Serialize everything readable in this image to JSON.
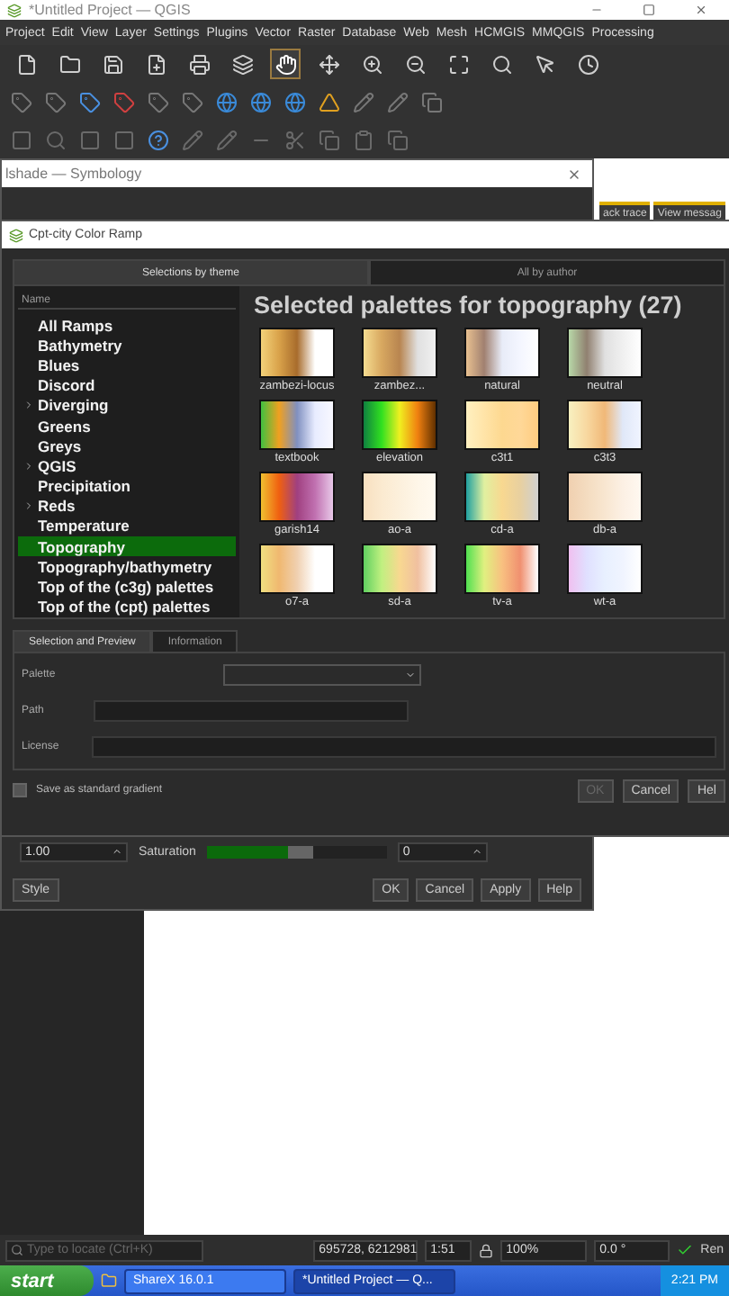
{
  "main_window": {
    "title": "*Untitled Project — QGIS"
  },
  "menu": [
    "Project",
    "Edit",
    "View",
    "Layer",
    "Settings",
    "Plugins",
    "Vector",
    "Raster",
    "Database",
    "Web",
    "Mesh",
    "HCMGIS",
    "MMQGIS",
    "Processing"
  ],
  "toolbar": {
    "tools": [
      {
        "selected": false
      },
      {
        "selected": false
      },
      {
        "selected": false
      },
      {
        "selected": false
      },
      {
        "selected": false
      },
      {
        "selected": false
      },
      {
        "selected": true
      },
      {
        "selected": false
      },
      {
        "selected": false
      },
      {
        "selected": false
      },
      {
        "selected": false
      },
      {
        "selected": false
      },
      {
        "selected": false
      },
      {
        "selected": false
      }
    ]
  },
  "dock_tabs": [
    "ack trace",
    "View messag"
  ],
  "symbology_dialog": {
    "title": "lshade — Symbology",
    "brightness_value": "1.00",
    "saturation_label": "Saturation",
    "saturation": {
      "level": 0.45
    },
    "saturation_value": "0",
    "style_button": "Style",
    "buttons": [
      "OK",
      "Cancel",
      "Apply",
      "Help"
    ]
  },
  "cpt_dialog": {
    "title": "Cpt-city Color Ramp",
    "tabs": [
      {
        "label": "Selections by theme",
        "selected": true
      },
      {
        "label": "All by author",
        "selected": false
      }
    ],
    "tree": {
      "header": "Name",
      "items": [
        {
          "label": "All Ramps",
          "expandable": false,
          "selected": false
        },
        {
          "label": "Bathymetry",
          "expandable": false,
          "selected": false
        },
        {
          "label": "Blues",
          "expandable": false,
          "selected": false
        },
        {
          "label": "Discord",
          "expandable": false,
          "selected": false
        },
        {
          "label": "Diverging",
          "expandable": true,
          "selected": false
        },
        {
          "label": "Greens",
          "expandable": false,
          "selected": false
        },
        {
          "label": "Greys",
          "expandable": false,
          "selected": false
        },
        {
          "label": "QGIS",
          "expandable": true,
          "selected": false
        },
        {
          "label": "Precipitation",
          "expandable": false,
          "selected": false
        },
        {
          "label": "Reds",
          "expandable": true,
          "selected": false
        },
        {
          "label": "Temperature",
          "expandable": false,
          "selected": false
        },
        {
          "label": "Topography",
          "expandable": false,
          "selected": true
        },
        {
          "label": "Topography/bathymetry",
          "expandable": false,
          "selected": false
        },
        {
          "label": "Top of the (c3g) palettes",
          "expandable": false,
          "selected": false
        },
        {
          "label": "Top of the (cpt) palettes",
          "expandable": false,
          "selected": false
        }
      ]
    },
    "heading": "Selected palettes for topography (27)",
    "palettes": [
      {
        "name": "zambezi-locus",
        "kind": "picture"
      },
      {
        "name": "zambez...",
        "kind": "picture"
      },
      {
        "name": "natural",
        "kind": "picture"
      },
      {
        "name": "neutral",
        "kind": "picture"
      },
      {
        "name": "textbook",
        "kind": "picture"
      },
      {
        "name": "elevation",
        "kind": "picture"
      },
      {
        "name": "c3t1",
        "kind": "picture"
      },
      {
        "name": "c3t3",
        "kind": "picture"
      },
      {
        "name": "garish14",
        "kind": "picture"
      },
      {
        "name": "ao-a",
        "kind": "picture"
      },
      {
        "name": "cd-a",
        "kind": "picture"
      },
      {
        "name": "db-a",
        "kind": "picture"
      },
      {
        "name": "o7-a",
        "kind": "picture"
      },
      {
        "name": "sd-a",
        "kind": "picture"
      },
      {
        "name": "tv-a",
        "kind": "picture"
      },
      {
        "name": "wt-a",
        "kind": "picture"
      }
    ],
    "detail_tabs": [
      {
        "label": "Selection and Preview",
        "selected": true
      },
      {
        "label": "Information",
        "selected": false
      }
    ],
    "fields": [
      {
        "label": "Palette",
        "kind": "dropdown"
      },
      {
        "label": "Path",
        "kind": "text"
      },
      {
        "label": "License",
        "kind": "text"
      }
    ],
    "save_standard": {
      "label": "Save as standard gradient",
      "checked": false
    },
    "buttons": [
      {
        "label": "OK",
        "disabled": true
      },
      {
        "label": "Cancel",
        "disabled": false
      },
      {
        "label": "Hel",
        "disabled": false
      }
    ]
  },
  "status_bar": {
    "locate_placeholder": "Type to locate (Ctrl+K)",
    "coordinate": "695728, 6212981",
    "scale": "1:51",
    "magnifier": "100%",
    "rotation": "0.0 °",
    "render": "Ren"
  },
  "taskbar": {
    "start": "start",
    "tasks": [
      {
        "label": "ShareX 16.0.1",
        "selected": false
      },
      {
        "label": "*Untitled Project — Q...",
        "selected": true
      }
    ],
    "clock": "2:21 PM"
  }
}
